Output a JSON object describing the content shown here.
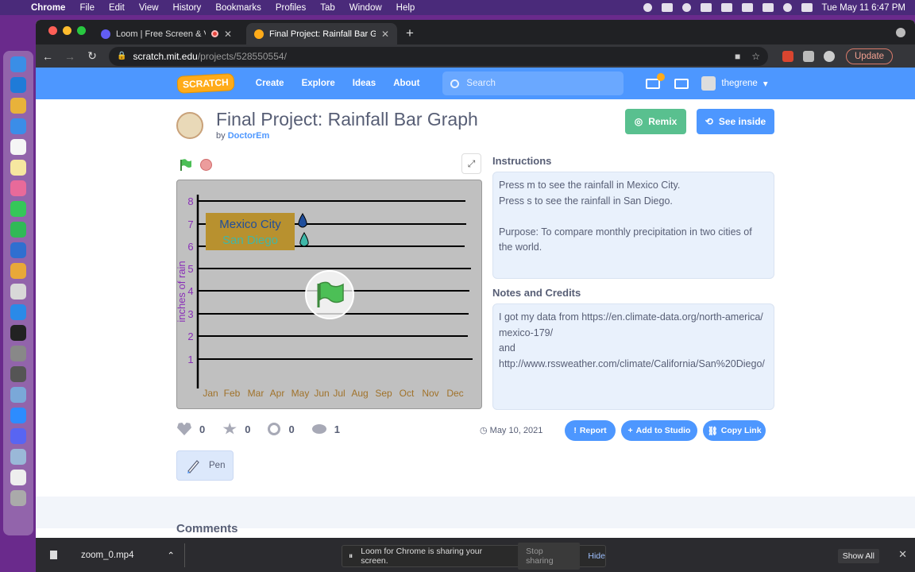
{
  "menubar": {
    "app": "Chrome",
    "items": [
      "File",
      "Edit",
      "View",
      "History",
      "Bookmarks",
      "Profiles",
      "Tab",
      "Window",
      "Help"
    ],
    "clock": "Tue May 11  6:47 PM"
  },
  "browser": {
    "tabs": [
      {
        "title": "Loom | Free Screen & Video"
      },
      {
        "title": "Final Project: Rainfall Bar Graph"
      }
    ],
    "url_host": "scratch.mit.edu",
    "url_path": "/projects/528550554/",
    "update_label": "Update"
  },
  "scratch_nav": {
    "logo": "SCRATCH",
    "links": [
      "Create",
      "Explore",
      "Ideas",
      "About"
    ],
    "search_placeholder": "Search",
    "username": "thegrene"
  },
  "project": {
    "title": "Final Project: Rainfall Bar Graph",
    "by_label": "by",
    "author": "DoctorEm",
    "remix_label": "Remix",
    "see_inside_label": "See inside",
    "instructions_title": "Instructions",
    "instructions": [
      "Press m to see the rainfall in Mexico City.",
      "Press s to see the rainfall in San Diego.",
      "",
      "Purpose: To compare monthly precipitation in two cities of the world."
    ],
    "notes_title": "Notes and Credits",
    "notes": [
      "I got my data from https://en.climate-data.org/north-america/mexico-179/",
      "and",
      "http://www.rssweather.com/climate/California/San%20Diego/"
    ],
    "stats": {
      "loves": "0",
      "favorites": "0",
      "remixes": "0",
      "views": "1"
    },
    "date": "May 10, 2021",
    "report_label": "Report",
    "add_to_studio_label": "Add to Studio",
    "copy_link_label": "Copy Link",
    "extension_label": "Pen",
    "comments_title": "Comments"
  },
  "stage": {
    "y_label": "inches of rain",
    "y_ticks": [
      "1",
      "2",
      "3",
      "4",
      "5",
      "6",
      "7",
      "8"
    ],
    "months": [
      "Jan",
      "Feb",
      "Mar",
      "Apr",
      "May",
      "Jun",
      "Jul",
      "Aug",
      "Sep",
      "Oct",
      "Nov",
      "Dec"
    ],
    "legend": [
      "Mexico City",
      "San Diego"
    ],
    "colors": {
      "mexico": "#1f4e9c",
      "sandiego": "#3fb7a8",
      "legend_bg": "#b8912f",
      "axis_text": "#a0722a",
      "ylabel": "#8a30b8"
    }
  },
  "download_bar": {
    "file": "zoom_0.mp4",
    "share_text": "Loom for Chrome is sharing your screen.",
    "stop_label": "Stop sharing",
    "hide_label": "Hide",
    "show_all_label": "Show All"
  }
}
